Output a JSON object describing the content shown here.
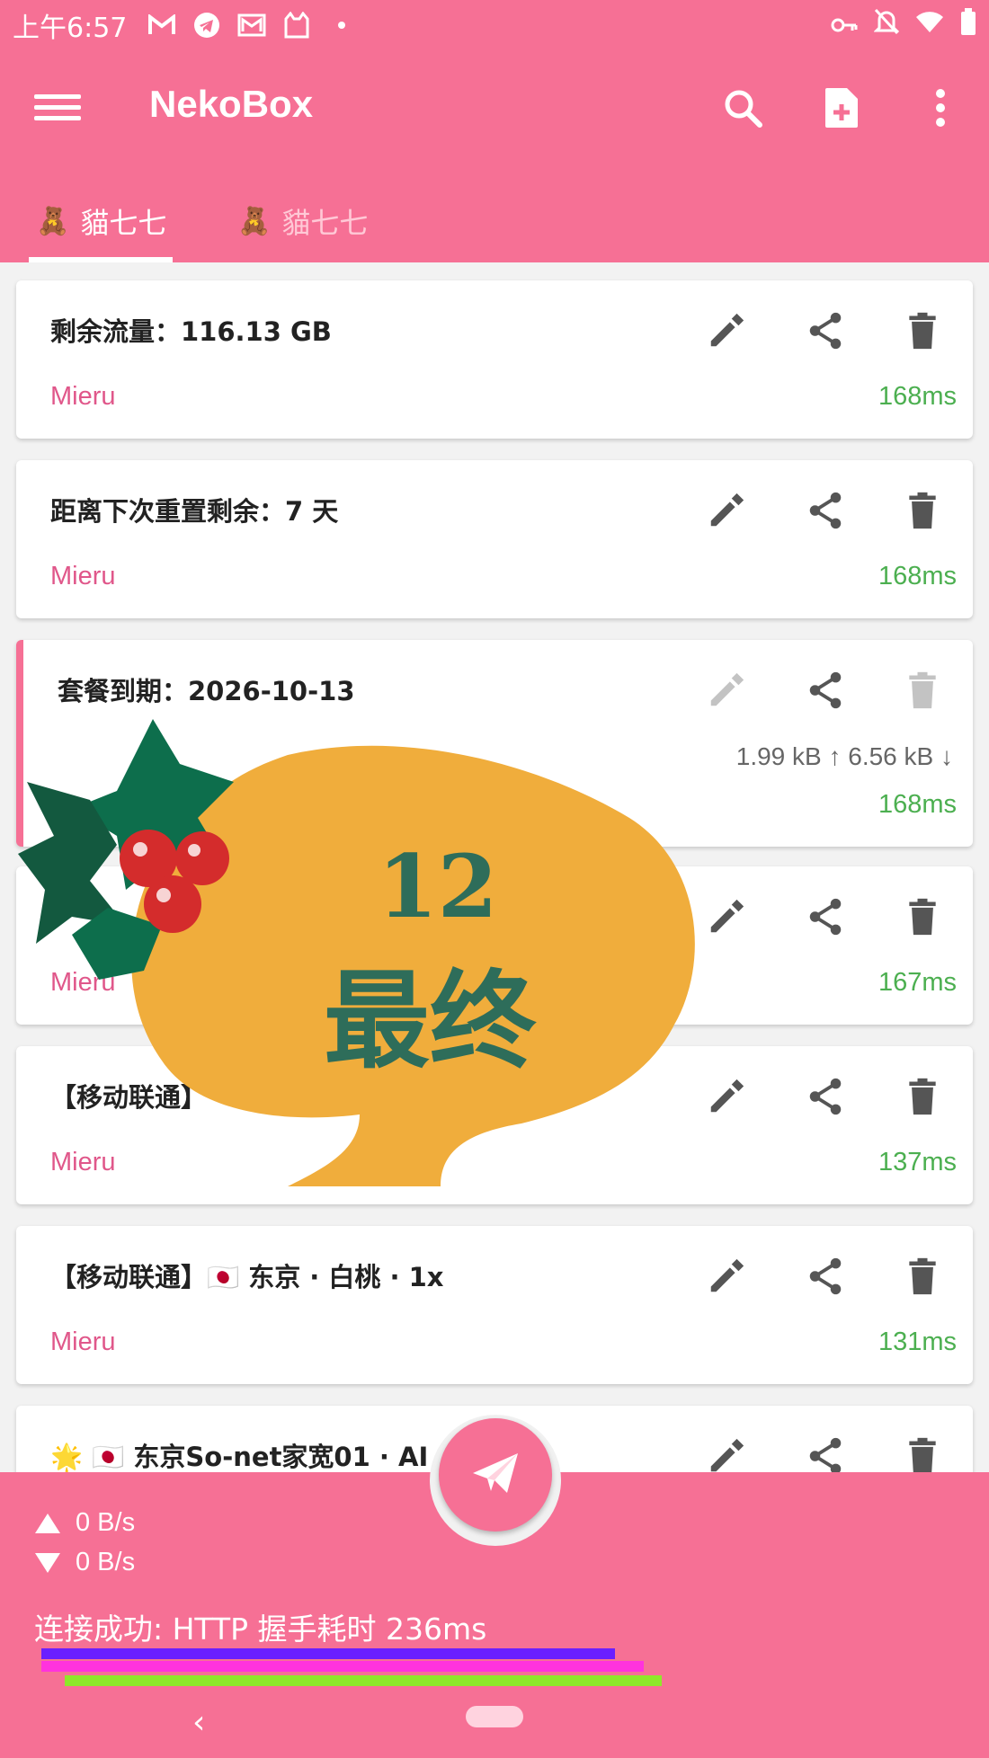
{
  "status_bar": {
    "time": "上午6:57"
  },
  "app_bar": {
    "title": "NekoBox"
  },
  "tabs": [
    {
      "emoji": "🧸",
      "label": "貓七七",
      "active": true
    },
    {
      "emoji": "🧸",
      "label": "貓七七",
      "active": false
    }
  ],
  "cards": [
    {
      "title": "剩余流量：116.13 GB",
      "type": "Mieru",
      "latency": "168ms"
    },
    {
      "title": "距离下次重置剩余：7 天",
      "type": "Mieru",
      "latency": "168ms"
    },
    {
      "title": "套餐到期：2026-10-13",
      "type": "",
      "latency": "168ms",
      "traffic": "1.99 kB ↑ 6.56 kB ↓",
      "selected": true
    },
    {
      "title": "",
      "type": "Mieru",
      "latency": "167ms"
    },
    {
      "title": "【移动联通】",
      "type": "Mieru",
      "latency": "137ms"
    },
    {
      "title": "【移动联通】🇯🇵 东京 · 白桃 · 1x",
      "type": "Mieru",
      "latency": "131ms"
    },
    {
      "title": "🌟 🇯🇵 东京So-net家宽01 · AI ·",
      "type": "",
      "latency": ""
    }
  ],
  "sticker": {
    "line1": "12",
    "line2": "最终"
  },
  "bottom": {
    "upload": "0 B/s",
    "download": "0 B/s",
    "status": "连接成功: HTTP 握手耗时 236ms"
  },
  "colors": {
    "primary": "#f67095",
    "latency_green": "#4caf50",
    "type_pink": "#e0578a"
  }
}
